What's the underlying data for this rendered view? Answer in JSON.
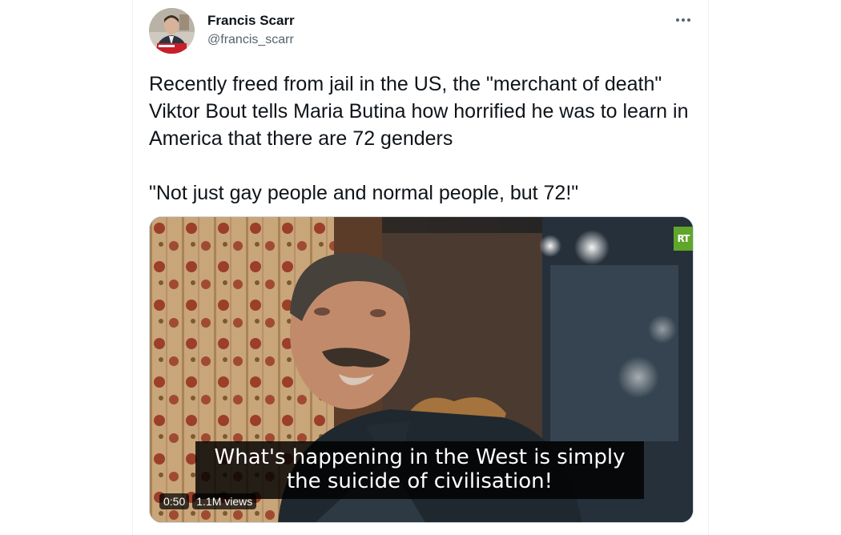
{
  "tweet": {
    "author_name": "Francis Scarr",
    "author_handle": "@francis_scarr",
    "text": "Recently freed from jail in the US, the \"merchant of death\" Viktor Bout tells Maria Butina how horrified he was to learn in America that there are 72 genders\n\n\"Not just gay people and normal people, but 72!\"",
    "more_icon": "ellipsis-icon"
  },
  "media": {
    "channel_logo": "RT",
    "subtitle_line1": "What's happening in the West is simply",
    "subtitle_line2": "the suicide of civilisation!",
    "duration": "0:50",
    "views": "1.1M views"
  },
  "colors": {
    "text": "#0f1419",
    "secondary": "#536471",
    "rt_green": "#5fa62a",
    "border": "#eff3f4"
  }
}
